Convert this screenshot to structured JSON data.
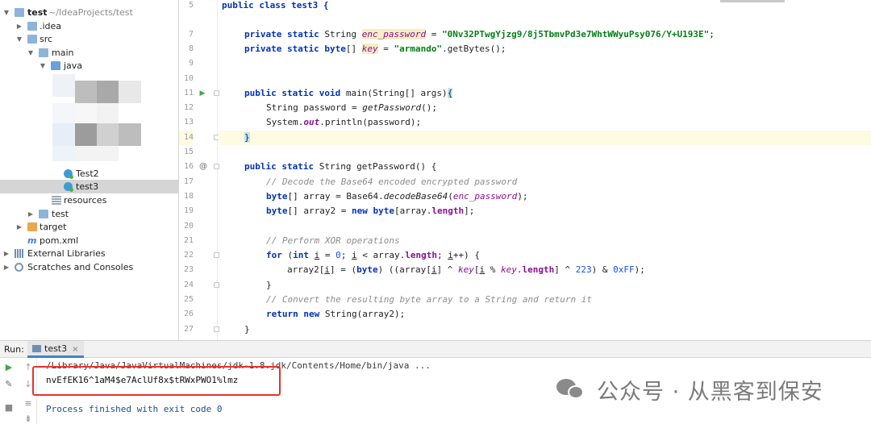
{
  "project_tree": {
    "items": [
      {
        "label": "test",
        "suffix": "~/IdeaProjects/test",
        "arrow": "▼",
        "icon": "project-folder-icon",
        "bold": true
      },
      {
        "label": ".idea",
        "arrow": "▶",
        "icon": "folder-icon"
      },
      {
        "label": "src",
        "arrow": "▼",
        "icon": "folder-icon"
      },
      {
        "label": "main",
        "arrow": "▼",
        "icon": "folder-icon"
      },
      {
        "label": "java",
        "arrow": "▼",
        "icon": "source-folder-icon"
      },
      {
        "label": "Test2",
        "arrow": "",
        "icon": "java-class-icon"
      },
      {
        "label": "test3",
        "arrow": "",
        "icon": "java-class-icon",
        "selected": true
      },
      {
        "label": "resources",
        "arrow": "",
        "icon": "resources-folder-icon"
      },
      {
        "label": "test",
        "arrow": "▶",
        "icon": "folder-icon"
      },
      {
        "label": "target",
        "arrow": "▶",
        "icon": "target-folder-icon"
      },
      {
        "label": "pom.xml",
        "arrow": "",
        "icon": "maven-icon"
      },
      {
        "label": "External Libraries",
        "arrow": "▶",
        "icon": "libraries-icon"
      },
      {
        "label": "Scratches and Consoles",
        "arrow": "▶",
        "icon": "scratches-icon"
      }
    ]
  },
  "editor": {
    "line_numbers": [
      "5",
      "7",
      "8",
      "9",
      "10",
      "11",
      "12",
      "13",
      "14",
      "15",
      "16",
      "17",
      "18",
      "19",
      "20",
      "21",
      "22",
      "23",
      "24",
      "25",
      "26",
      "27"
    ],
    "lines": {
      "l5": "public class test3 {",
      "l7a": "private static ",
      "l7b": "String ",
      "l7c": "enc_password",
      "l7d": " = ",
      "l7e": "\"0Nv32PTwgYjzg9/8j5TbmvPd3e7WhtWWyuPsy076/Y+U193E\"",
      "l7f": ";",
      "l8a": "private static byte",
      "l8b": "[] ",
      "l8c": "key",
      "l8d": " = ",
      "l8e": "\"armando\"",
      "l8f": ".getBytes();",
      "l11a": "public static void ",
      "l11b": "main(String[] args)",
      "l11c": "{",
      "l12a": "String password = ",
      "l12b": "getPassword",
      "l12c": "();",
      "l13a": "System.",
      "l13b": "out",
      "l13c": ".println(password);",
      "l14": "}",
      "l16a": "public static ",
      "l16b": "String getPassword() {",
      "l17": "// Decode the Base64 encoded encrypted password",
      "l18a": "byte",
      "l18b": "[] array = Base64.",
      "l18c": "decodeBase64",
      "l18d": "(",
      "l18e": "enc_password",
      "l18f": ");",
      "l19a": "byte",
      "l19b": "[] array2 = ",
      "l19c": "new byte",
      "l19d": "[array.",
      "l19e": "length",
      "l19f": "];",
      "l21": "// Perform XOR operations",
      "l22a": "for ",
      "l22b": "(",
      "l22c": "int ",
      "l22d": "i",
      "l22e": " = ",
      "l22f": "0",
      "l22g": "; ",
      "l22h": "i",
      "l22i": " < array.",
      "l22j": "length",
      "l22k": "; ",
      "l22l": "i",
      "l22m": "++) {",
      "l23a": "array2[",
      "l23b": "i",
      "l23c": "] = (",
      "l23d": "byte",
      "l23e": ") ((array[",
      "l23f": "i",
      "l23g": "] ^ ",
      "l23h": "key",
      "l23i": "[",
      "l23j": "i",
      "l23k": " % ",
      "l23l": "key",
      "l23m": ".",
      "l23n": "length",
      "l23o": "] ^ ",
      "l23p": "223",
      "l23q": ") & ",
      "l23r": "0xFF",
      "l23s": ");",
      "l24": "}",
      "l25": "// Convert the resulting byte array to a String and return it",
      "l26a": "return new ",
      "l26b": "String(array2);",
      "l27": "}"
    }
  },
  "run_panel": {
    "label": "Run:",
    "tab": "test3",
    "tab_close": "×",
    "console": {
      "path": "/Library/Java/JavaVirtualMachines/jdk-1.8.jdk/Contents/Home/bin/java ...",
      "output": "nvEfEK16^1aM4$e7AclUf8x$tRWxPWO1%lmz",
      "finished": "Process finished with exit code 0"
    }
  },
  "watermark": {
    "text": "公众号 · 从黑客到保安"
  },
  "colors": {
    "keyword": "#0033b3",
    "string": "#067d17",
    "field": "#871094",
    "comment": "#8c8c8c",
    "number": "#1750eb",
    "highlight_box": "#e5332a"
  }
}
